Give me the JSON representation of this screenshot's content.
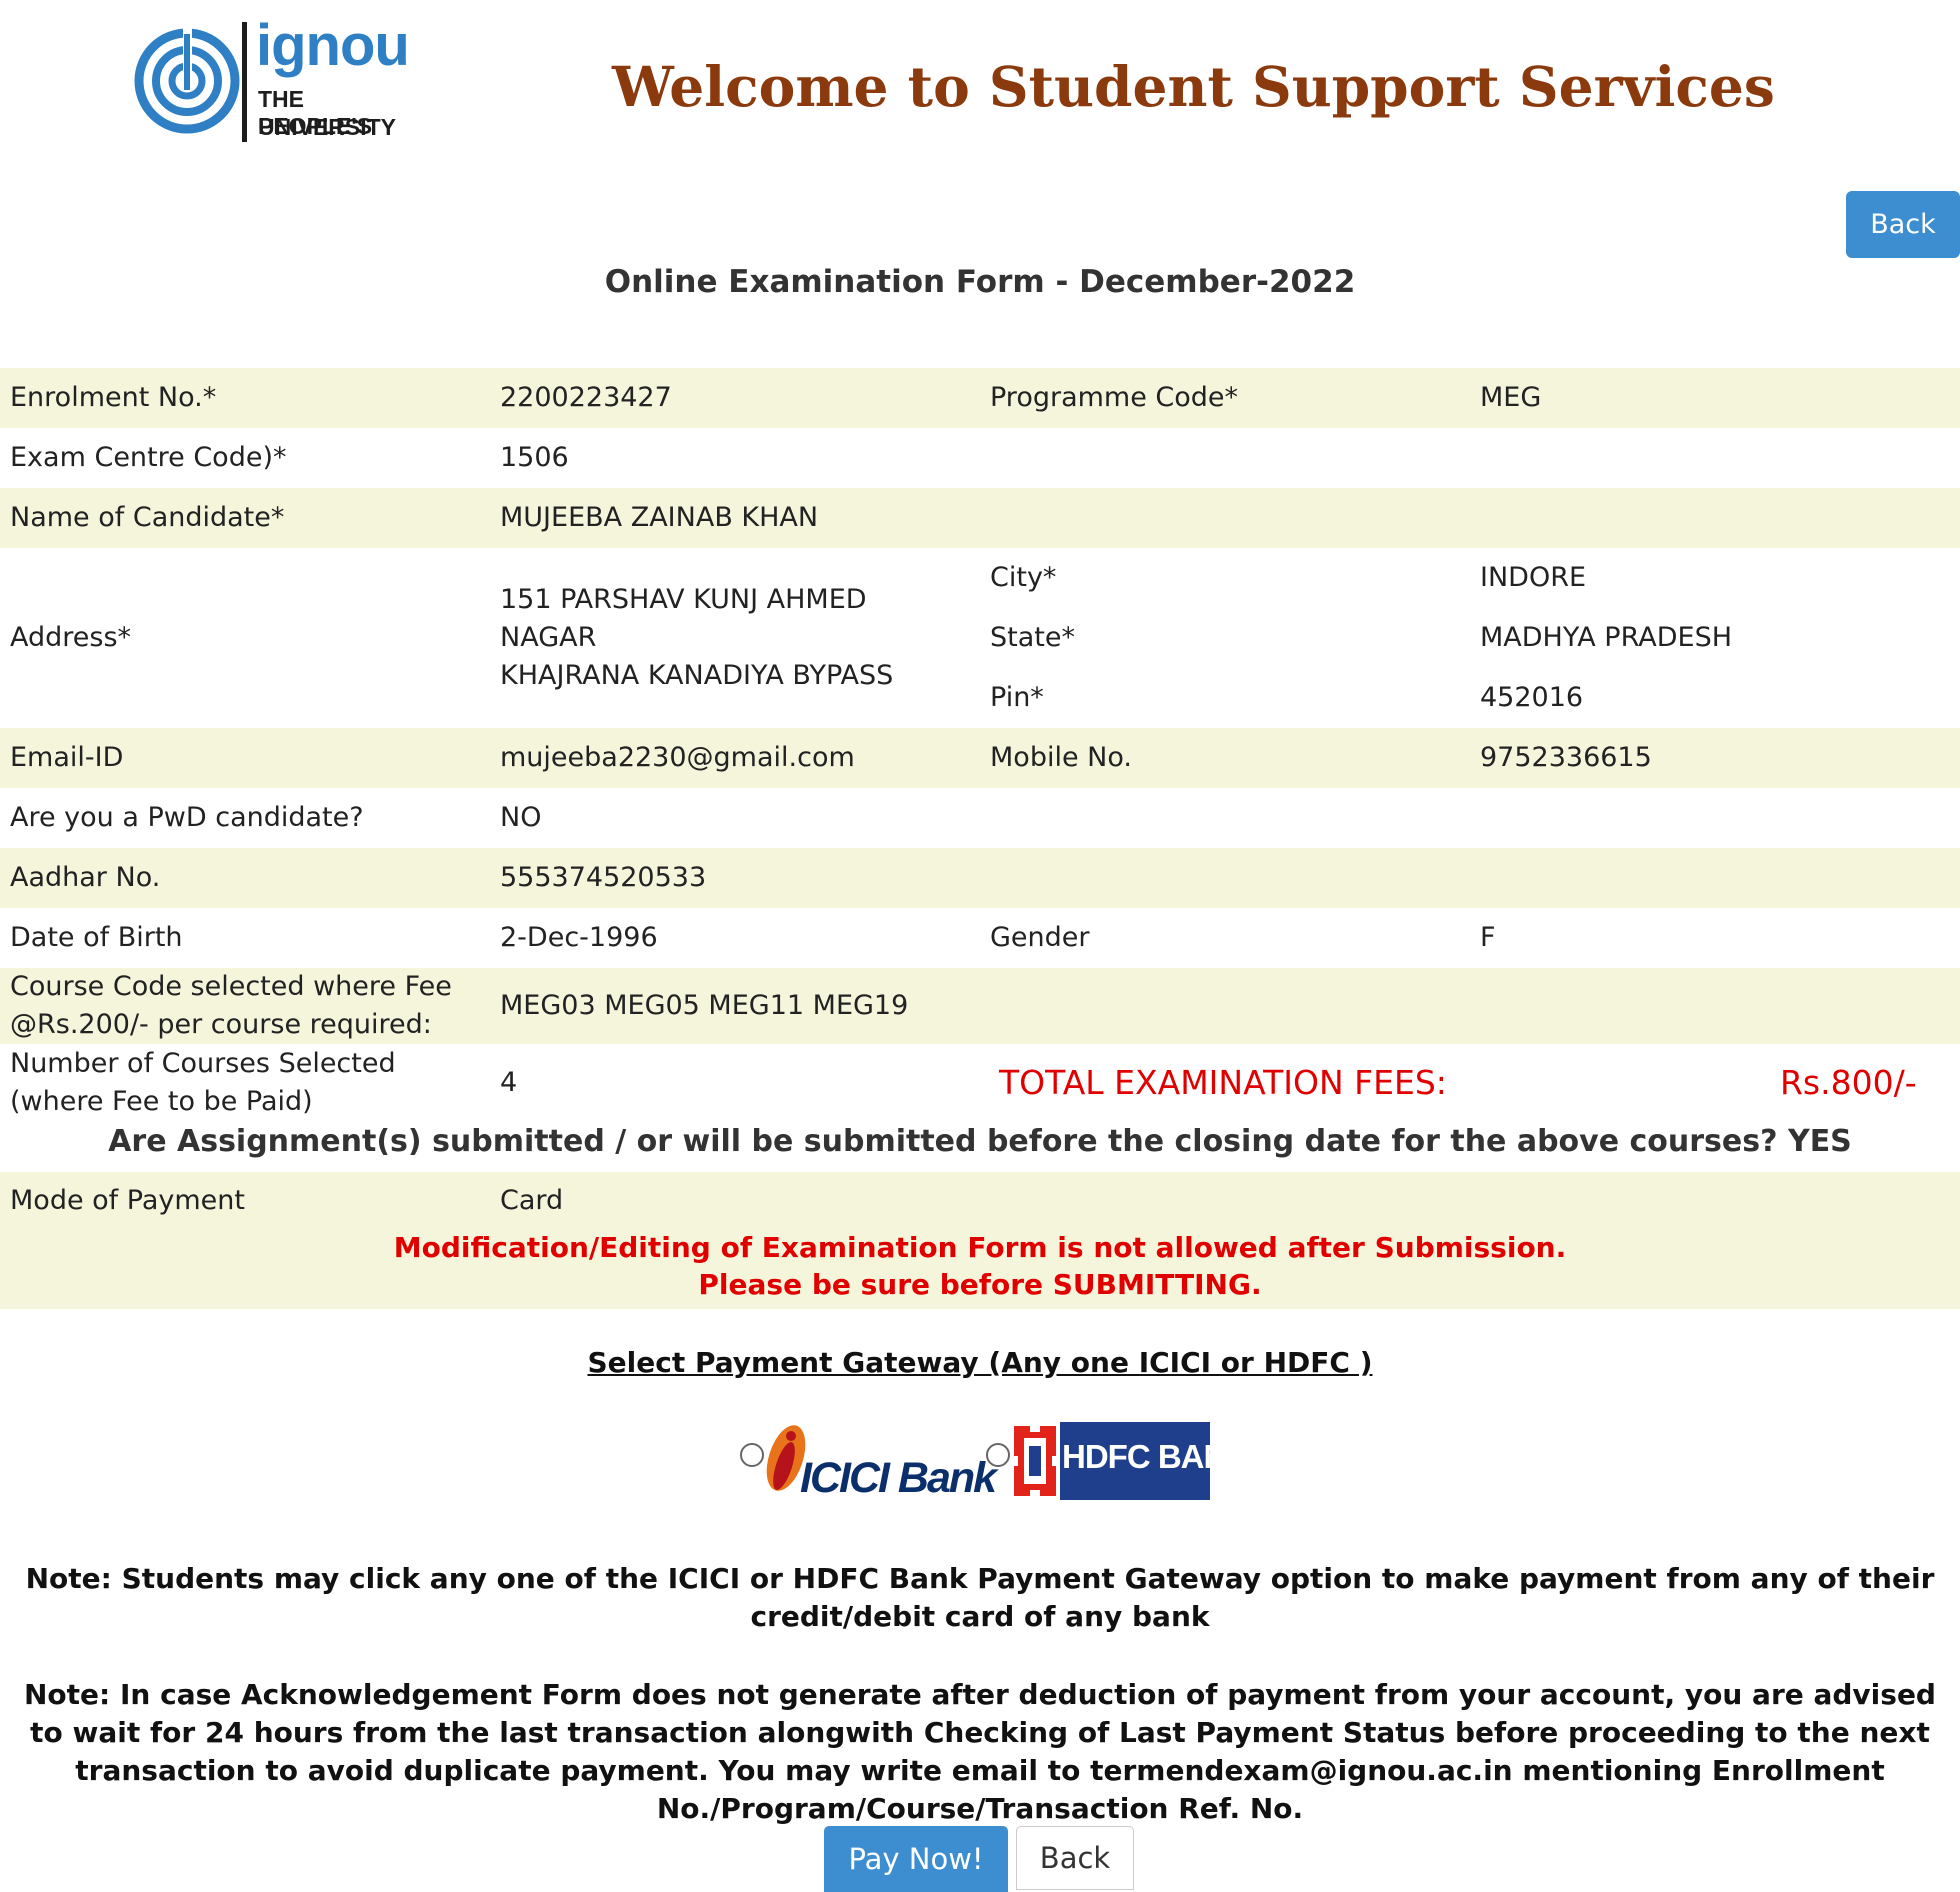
{
  "header": {
    "logo_word": "ignou",
    "logo_line1": "THE PEOPLE'S",
    "logo_line2": "UNIVERSITY",
    "welcome": "Welcome to Student Support Services",
    "back_label": "Back"
  },
  "form_title": "Online Examination Form - December-2022",
  "rows": {
    "enrolment": {
      "label": "Enrolment No.*",
      "value": "2200223427",
      "label2": "Programme Code*",
      "value2": "MEG"
    },
    "exam_centre": {
      "label": "Exam Centre Code)*",
      "value": "1506"
    },
    "name": {
      "label": "Name of Candidate*",
      "value": "MUJEEBA ZAINAB KHAN"
    },
    "address": {
      "label": "Address*",
      "line1": "151 PARSHAV KUNJ AHMED",
      "line2": "NAGAR",
      "line3": "KHAJRANA KANADIYA BYPASS",
      "city_label": "City*",
      "city": "INDORE",
      "state_label": "State*",
      "state": "MADHYA PRADESH",
      "pin_label": "Pin*",
      "pin": "452016"
    },
    "email": {
      "label": "Email-ID",
      "value": "mujeeba2230@gmail.com",
      "label2": "Mobile No.",
      "value2": "9752336615"
    },
    "pwd": {
      "label": "Are you a PwD candidate?",
      "value": "NO"
    },
    "aadhar": {
      "label": "Aadhar No.",
      "value": "555374520533"
    },
    "dob": {
      "label": "Date of Birth",
      "value": "2-Dec-1996",
      "label2": "Gender",
      "value2": "F"
    },
    "courses": {
      "label_line1": "Course Code selected where Fee",
      "label_line2": "@Rs.200/- per course required:",
      "value": "MEG03 MEG05 MEG11 MEG19"
    },
    "num_courses": {
      "label_line1": "Number of Courses Selected",
      "label_line2": "(where Fee to be Paid)",
      "value": "4",
      "fees_label": "TOTAL EXAMINATION FEES:",
      "fees_value": "Rs.800/-"
    },
    "payment_mode": {
      "label": "Mode of Payment",
      "value": "Card"
    }
  },
  "assignment_text": "Are Assignment(s) submitted / or will be submitted before the closing date for the above courses? YES",
  "warning": {
    "line1": "Modification/Editing of Examination Form is not allowed after Submission.",
    "line2": "Please be sure before SUBMITTING."
  },
  "gateway": {
    "title": "Select Payment Gateway (Any one ICICI or HDFC )",
    "icici_label": "ICICI Bank",
    "hdfc_label": "HDFC BANK",
    "colors": {
      "icici_orange": "#e8731a",
      "icici_red": "#b5121b",
      "icici_blue": "#0b2f6b",
      "hdfc_blue": "#1f3e8c",
      "hdfc_red": "#e2231a"
    }
  },
  "notes": {
    "note1": "Note: Students may click any one of the ICICI or HDFC Bank Payment Gateway option to make payment from any of their credit/debit card of any bank",
    "note2": "Note: In case Acknowledgement Form does not generate after deduction of payment from your account, you are advised to wait for 24 hours from the last transaction alongwith Checking of Last Payment Status before proceeding to the next transaction to avoid duplicate payment. You may write email to termendexam@ignou.ac.in mentioning Enrollment No./Program/Course/Transaction Ref. No."
  },
  "actions": {
    "pay_label": "Pay Now!",
    "back_label": "Back"
  },
  "colors": {
    "title_brown": "#8b3a0e",
    "button_blue": "#3d8ed1",
    "row_shade": "#f5f5dc",
    "warning_red": "#e00000",
    "logo_blue": "#2e7fc4"
  }
}
